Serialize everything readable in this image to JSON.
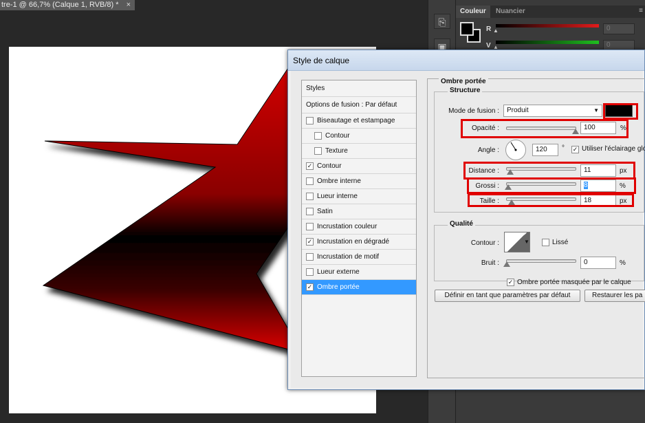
{
  "document": {
    "tab_title": "tre-1 @ 66,7% (Calque 1, RVB/8) *",
    "close": "×"
  },
  "color_panel": {
    "tabs": [
      "Couleur",
      "Nuancier"
    ],
    "menu_icon": "≡",
    "channels": [
      {
        "label": "R",
        "value": "0",
        "color": "#e21b1b"
      },
      {
        "label": "V",
        "value": "0",
        "color": "#1fbf1f"
      }
    ]
  },
  "dialog": {
    "title": "Style de calque",
    "styles_list": {
      "header": "Styles",
      "options": "Options de fusion : Par défaut",
      "items": [
        {
          "label": "Biseautage et estampage",
          "checked": false,
          "indent": false
        },
        {
          "label": "Contour",
          "checked": false,
          "indent": true
        },
        {
          "label": "Texture",
          "checked": false,
          "indent": true
        },
        {
          "label": "Contour",
          "checked": true,
          "indent": false
        },
        {
          "label": "Ombre interne",
          "checked": false,
          "indent": false
        },
        {
          "label": "Lueur interne",
          "checked": false,
          "indent": false
        },
        {
          "label": "Satin",
          "checked": false,
          "indent": false
        },
        {
          "label": "Incrustation couleur",
          "checked": false,
          "indent": false
        },
        {
          "label": "Incrustation en dégradé",
          "checked": true,
          "indent": false
        },
        {
          "label": "Incrustation de motif",
          "checked": false,
          "indent": false
        },
        {
          "label": "Lueur externe",
          "checked": false,
          "indent": false
        },
        {
          "label": "Ombre portée",
          "checked": true,
          "indent": false,
          "selected": true
        }
      ]
    },
    "drop_shadow": {
      "section_title": "Ombre portée",
      "structure_title": "Structure",
      "blend_mode_label": "Mode de fusion :",
      "blend_mode_value": "Produit",
      "shadow_color": "#000000",
      "opacity_label": "Opacité :",
      "opacity_value": "100",
      "opacity_unit": "%",
      "opacity_level": 1.0,
      "angle_label": "Angle :",
      "angle_value": "120",
      "angle_unit": "°",
      "global_light_label": "Utiliser l'éclairage glob",
      "global_light_checked": true,
      "distance_label": "Distance :",
      "distance_value": "11",
      "distance_unit": "px",
      "distance_level": 0.05,
      "spread_label": "Grossi :",
      "spread_value": "8",
      "spread_unit": "%",
      "spread_level": 0.02,
      "size_label": "Taille :",
      "size_value": "18",
      "size_unit": "px",
      "size_level": 0.07,
      "quality_title": "Qualité",
      "contour_label": "Contour :",
      "antialias_label": "Lissé",
      "antialias_checked": false,
      "noise_label": "Bruit :",
      "noise_value": "0",
      "noise_unit": "%",
      "noise_level": 0.0,
      "knockout_label": "Ombre portée masquée par le calque",
      "knockout_checked": true,
      "make_default_button": "Définir en tant que paramètres par défaut",
      "reset_default_button": "Restaurer les pa"
    }
  },
  "colors": {
    "highlight": "#e00000",
    "selection": "#3399ff",
    "shape_red": "#d40000"
  }
}
